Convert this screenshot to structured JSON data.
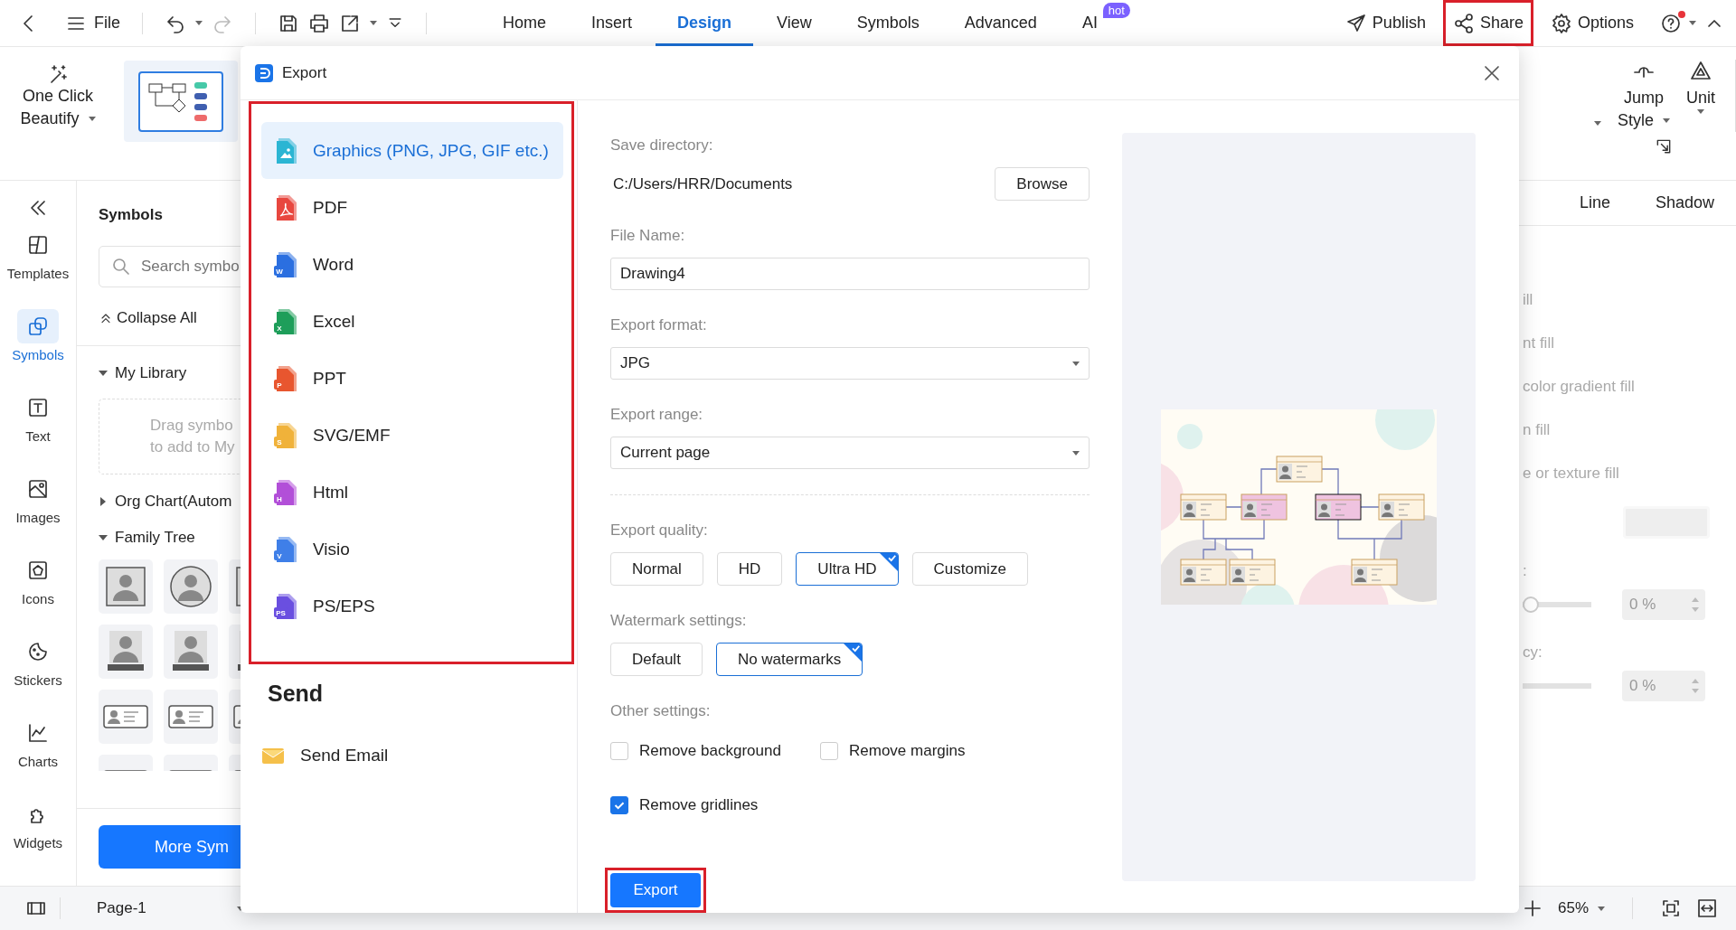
{
  "topbar": {
    "file_menu": "File",
    "tabs": [
      {
        "label": "Home",
        "selected": false
      },
      {
        "label": "Insert",
        "selected": false
      },
      {
        "label": "Design",
        "selected": true
      },
      {
        "label": "View",
        "selected": false
      },
      {
        "label": "Symbols",
        "selected": false
      },
      {
        "label": "Advanced",
        "selected": false
      },
      {
        "label": "AI",
        "selected": false,
        "badge": "hot"
      }
    ],
    "actions": [
      {
        "label": "Publish",
        "highlighted": false
      },
      {
        "label": "Share",
        "highlighted": true
      },
      {
        "label": "Options",
        "highlighted": false
      }
    ],
    "help_notification": true
  },
  "ribbon": {
    "beautify": [
      "One Click",
      "Beautify"
    ],
    "jump_style": [
      "Jump",
      "Style"
    ],
    "unit": "Unit"
  },
  "rail": [
    {
      "label": "Templates",
      "selected": false
    },
    {
      "label": "Symbols",
      "selected": true
    },
    {
      "label": "Text",
      "selected": false
    },
    {
      "label": "Images",
      "selected": false
    },
    {
      "label": "Icons",
      "selected": false
    },
    {
      "label": "Stickers",
      "selected": false
    },
    {
      "label": "Charts",
      "selected": false
    },
    {
      "label": "Widgets",
      "selected": false
    }
  ],
  "symbols_panel": {
    "title": "Symbols",
    "search_placeholder": "Search symbo",
    "collapse_all": "Collapse All",
    "sections": [
      {
        "label": "My Library",
        "expanded": true
      },
      {
        "label": "Org Chart(Autom",
        "expanded": false
      },
      {
        "label": "Family Tree",
        "expanded": true
      }
    ],
    "drop_hint": [
      "Drag symbo",
      "to add to My"
    ],
    "more_button": "More Sym"
  },
  "right_panel": {
    "tabs": [
      "Line",
      "Shadow"
    ],
    "fill_options": [
      "ill",
      "nt fill",
      "color gradient fill",
      "n fill",
      "e or texture fill"
    ],
    "sliders": [
      {
        "label": ":",
        "level": 0,
        "reading": "0 %"
      },
      {
        "label": "cy:",
        "reading": "0 %"
      }
    ]
  },
  "dialog": {
    "title": "Export",
    "formats_highlighted": true,
    "formats": [
      {
        "label": "Graphics (PNG, JPG, GIF etc.)",
        "selected": true,
        "color": "#2bb5d3"
      },
      {
        "label": "PDF",
        "selected": false,
        "color": "#e8473f"
      },
      {
        "label": "Word",
        "selected": false,
        "color": "#2b6fe0",
        "badge": "W"
      },
      {
        "label": "Excel",
        "selected": false,
        "color": "#1e9e5a",
        "badge": "X"
      },
      {
        "label": "PPT",
        "selected": false,
        "color": "#e8562f",
        "badge": "P"
      },
      {
        "label": "SVG/EMF",
        "selected": false,
        "color": "#f0b23a",
        "badge": "S"
      },
      {
        "label": "Html",
        "selected": false,
        "color": "#b24fd8",
        "badge": "H"
      },
      {
        "label": "Visio",
        "selected": false,
        "color": "#3f7fe8",
        "badge": "V"
      },
      {
        "label": "PS/EPS",
        "selected": false,
        "color": "#6a4fe0",
        "badge": "PS"
      }
    ],
    "send_title": "Send",
    "send_items": [
      "Send Email"
    ],
    "save_directory": {
      "label": "Save directory:",
      "value": "C:/Users/HRR/Documents",
      "button": "Browse"
    },
    "file_name": {
      "label": "File Name:",
      "value": "Drawing4"
    },
    "export_format": {
      "label": "Export format:",
      "value": "JPG"
    },
    "export_range": {
      "label": "Export range:",
      "value": "Current page"
    },
    "quality": {
      "label": "Export quality:",
      "options": [
        {
          "label": "Normal",
          "selected": false
        },
        {
          "label": "HD",
          "selected": false
        },
        {
          "label": "Ultra HD",
          "selected": true
        },
        {
          "label": "Customize",
          "selected": false
        }
      ]
    },
    "watermark": {
      "label": "Watermark settings:",
      "options": [
        {
          "label": "Default",
          "selected": false
        },
        {
          "label": "No watermarks",
          "selected": true
        }
      ]
    },
    "other": {
      "label": "Other settings:",
      "options": [
        {
          "label": "Remove background",
          "checked": false
        },
        {
          "label": "Remove margins",
          "checked": false
        },
        {
          "label": "Remove gridlines",
          "checked": true
        }
      ]
    },
    "export_button": {
      "label": "Export",
      "highlighted": true
    }
  },
  "status_bar": {
    "page": "Page-1",
    "zoom": "65%"
  }
}
